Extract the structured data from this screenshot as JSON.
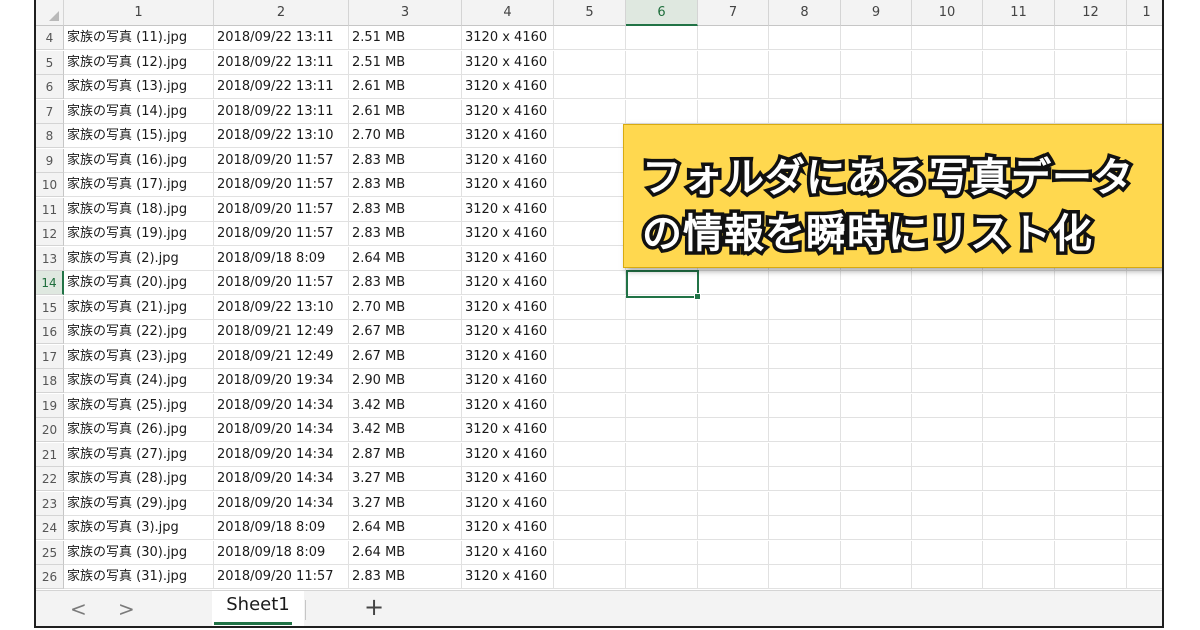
{
  "columns": [
    "1",
    "2",
    "3",
    "4",
    "5",
    "6",
    "7",
    "8",
    "9",
    "10",
    "11",
    "12",
    "1"
  ],
  "selected_column": "6",
  "selected_row": "14",
  "rows": [
    {
      "num": "4",
      "name": "家族の写真 (11).jpg",
      "date": "2018/09/22 13:11",
      "size": "2.51 MB",
      "dims": "3120 x 4160"
    },
    {
      "num": "5",
      "name": "家族の写真 (12).jpg",
      "date": "2018/09/22 13:11",
      "size": "2.51 MB",
      "dims": "3120 x 4160"
    },
    {
      "num": "6",
      "name": "家族の写真 (13).jpg",
      "date": "2018/09/22 13:11",
      "size": "2.61 MB",
      "dims": "3120 x 4160"
    },
    {
      "num": "7",
      "name": "家族の写真 (14).jpg",
      "date": "2018/09/22 13:11",
      "size": "2.61 MB",
      "dims": "3120 x 4160"
    },
    {
      "num": "8",
      "name": "家族の写真 (15).jpg",
      "date": "2018/09/22 13:10",
      "size": "2.70 MB",
      "dims": "3120 x 4160"
    },
    {
      "num": "9",
      "name": "家族の写真 (16).jpg",
      "date": "2018/09/20 11:57",
      "size": "2.83 MB",
      "dims": "3120 x 4160"
    },
    {
      "num": "10",
      "name": "家族の写真 (17).jpg",
      "date": "2018/09/20 11:57",
      "size": "2.83 MB",
      "dims": "3120 x 4160"
    },
    {
      "num": "11",
      "name": "家族の写真 (18).jpg",
      "date": "2018/09/20 11:57",
      "size": "2.83 MB",
      "dims": "3120 x 4160"
    },
    {
      "num": "12",
      "name": "家族の写真 (19).jpg",
      "date": "2018/09/20 11:57",
      "size": "2.83 MB",
      "dims": "3120 x 4160"
    },
    {
      "num": "13",
      "name": "家族の写真 (2).jpg",
      "date": "2018/09/18 8:09",
      "size": "2.64 MB",
      "dims": "3120 x 4160"
    },
    {
      "num": "14",
      "name": "家族の写真 (20).jpg",
      "date": "2018/09/20 11:57",
      "size": "2.83 MB",
      "dims": "3120 x 4160"
    },
    {
      "num": "15",
      "name": "家族の写真 (21).jpg",
      "date": "2018/09/22 13:10",
      "size": "2.70 MB",
      "dims": "3120 x 4160"
    },
    {
      "num": "16",
      "name": "家族の写真 (22).jpg",
      "date": "2018/09/21 12:49",
      "size": "2.67 MB",
      "dims": "3120 x 4160"
    },
    {
      "num": "17",
      "name": "家族の写真 (23).jpg",
      "date": "2018/09/21 12:49",
      "size": "2.67 MB",
      "dims": "3120 x 4160"
    },
    {
      "num": "18",
      "name": "家族の写真 (24).jpg",
      "date": "2018/09/20 19:34",
      "size": "2.90 MB",
      "dims": "3120 x 4160"
    },
    {
      "num": "19",
      "name": "家族の写真 (25).jpg",
      "date": "2018/09/20 14:34",
      "size": "3.42 MB",
      "dims": "3120 x 4160"
    },
    {
      "num": "20",
      "name": "家族の写真 (26).jpg",
      "date": "2018/09/20 14:34",
      "size": "3.42 MB",
      "dims": "3120 x 4160"
    },
    {
      "num": "21",
      "name": "家族の写真 (27).jpg",
      "date": "2018/09/20 14:34",
      "size": "2.87 MB",
      "dims": "3120 x 4160"
    },
    {
      "num": "22",
      "name": "家族の写真 (28).jpg",
      "date": "2018/09/20 14:34",
      "size": "3.27 MB",
      "dims": "3120 x 4160"
    },
    {
      "num": "23",
      "name": "家族の写真 (29).jpg",
      "date": "2018/09/20 14:34",
      "size": "3.27 MB",
      "dims": "3120 x 4160"
    },
    {
      "num": "24",
      "name": "家族の写真 (3).jpg",
      "date": "2018/09/18 8:09",
      "size": "2.64 MB",
      "dims": "3120 x 4160"
    },
    {
      "num": "25",
      "name": "家族の写真 (30).jpg",
      "date": "2018/09/18 8:09",
      "size": "2.64 MB",
      "dims": "3120 x 4160"
    },
    {
      "num": "26",
      "name": "家族の写真 (31).jpg",
      "date": "2018/09/20 11:57",
      "size": "2.83 MB",
      "dims": "3120 x 4160"
    }
  ],
  "callout": {
    "line1": "フォルダにある写真データ",
    "line2": "の情報を瞬時にリスト化"
  },
  "tabs": {
    "prev_icon": "<",
    "next_icon": ">",
    "active_sheet": "Sheet1",
    "add_icon": "+"
  },
  "colors": {
    "accent": "#217346",
    "callout_bg": "#ffd84f"
  }
}
